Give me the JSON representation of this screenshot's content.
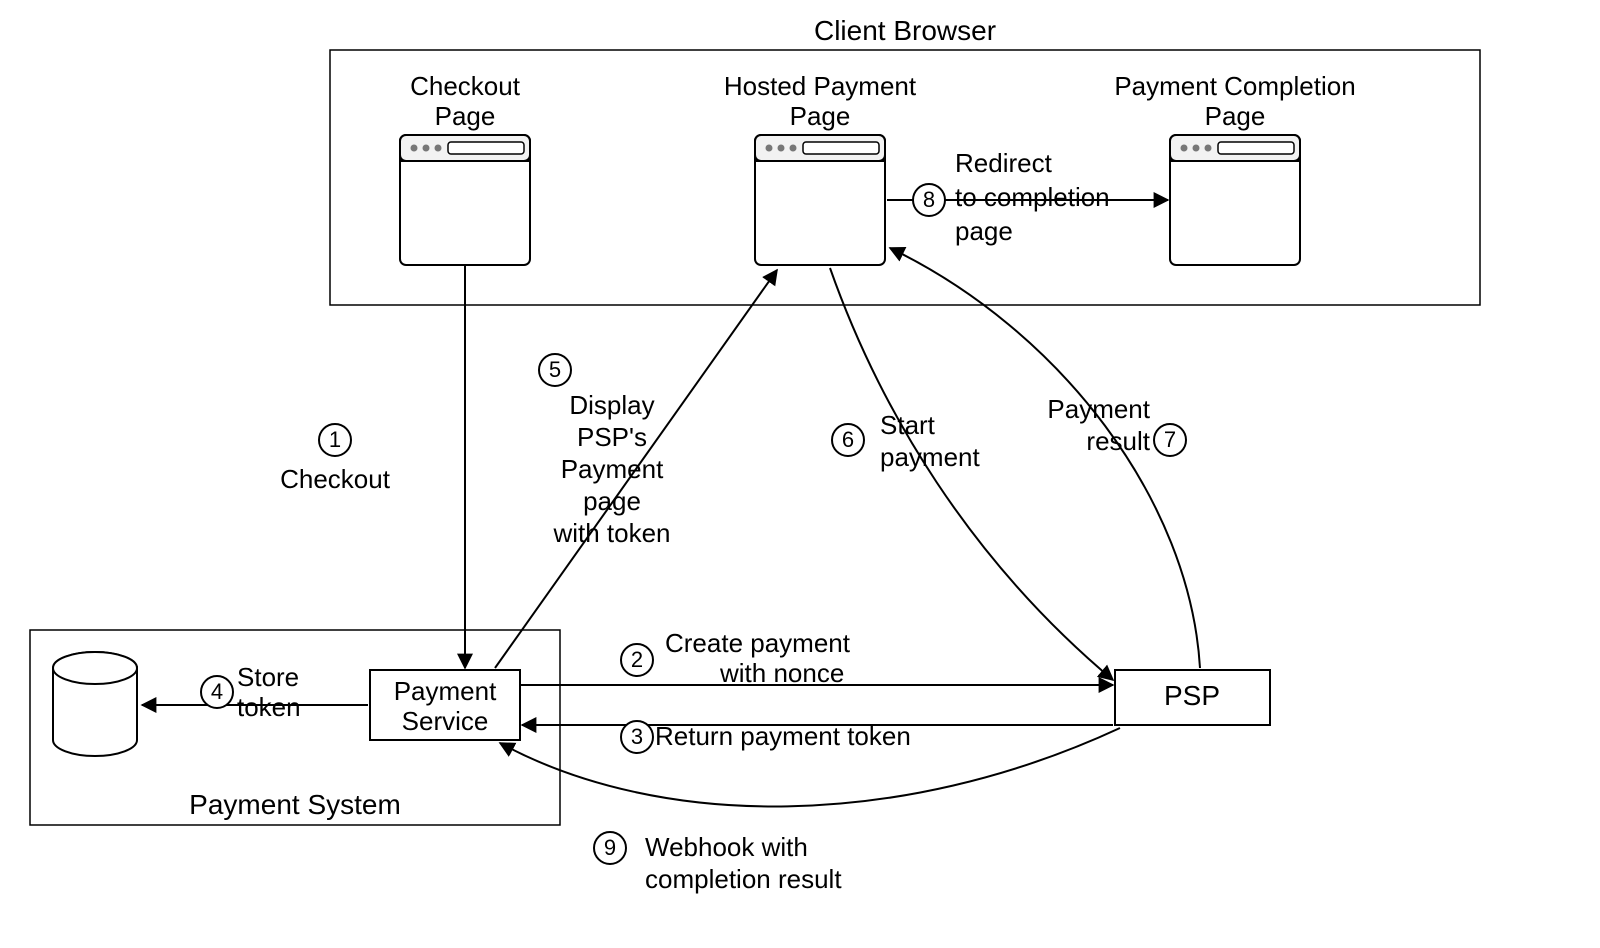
{
  "groups": {
    "client_browser": "Client Browser",
    "payment_system": "Payment System"
  },
  "nodes": {
    "checkout_page_l1": "Checkout",
    "checkout_page_l2": "Page",
    "hosted_page_l1": "Hosted Payment",
    "hosted_page_l2": "Page",
    "completion_page_l1": "Payment Completion",
    "completion_page_l2": "Page",
    "payment_service_l1": "Payment",
    "payment_service_l2": "Service",
    "psp": "PSP"
  },
  "steps": {
    "s1": {
      "num": "1",
      "text": "Checkout"
    },
    "s2": {
      "num": "2",
      "l1": "Create payment",
      "l2": "with nonce"
    },
    "s3": {
      "num": "3",
      "text": "Return payment token"
    },
    "s4": {
      "num": "4",
      "l1": "Store",
      "l2": "token"
    },
    "s5": {
      "num": "5",
      "l1": "Display",
      "l2": "PSP's",
      "l3": "Payment",
      "l4": "page",
      "l5": "with token"
    },
    "s6": {
      "num": "6",
      "l1": "Start",
      "l2": "payment"
    },
    "s7": {
      "num": "7",
      "l1": "Payment",
      "l2": "result"
    },
    "s8": {
      "num": "8",
      "l1": "Redirect",
      "l2": "to completion",
      "l3": "page"
    },
    "s9": {
      "num": "9",
      "l1": "Webhook  with",
      "l2": "completion result"
    }
  }
}
